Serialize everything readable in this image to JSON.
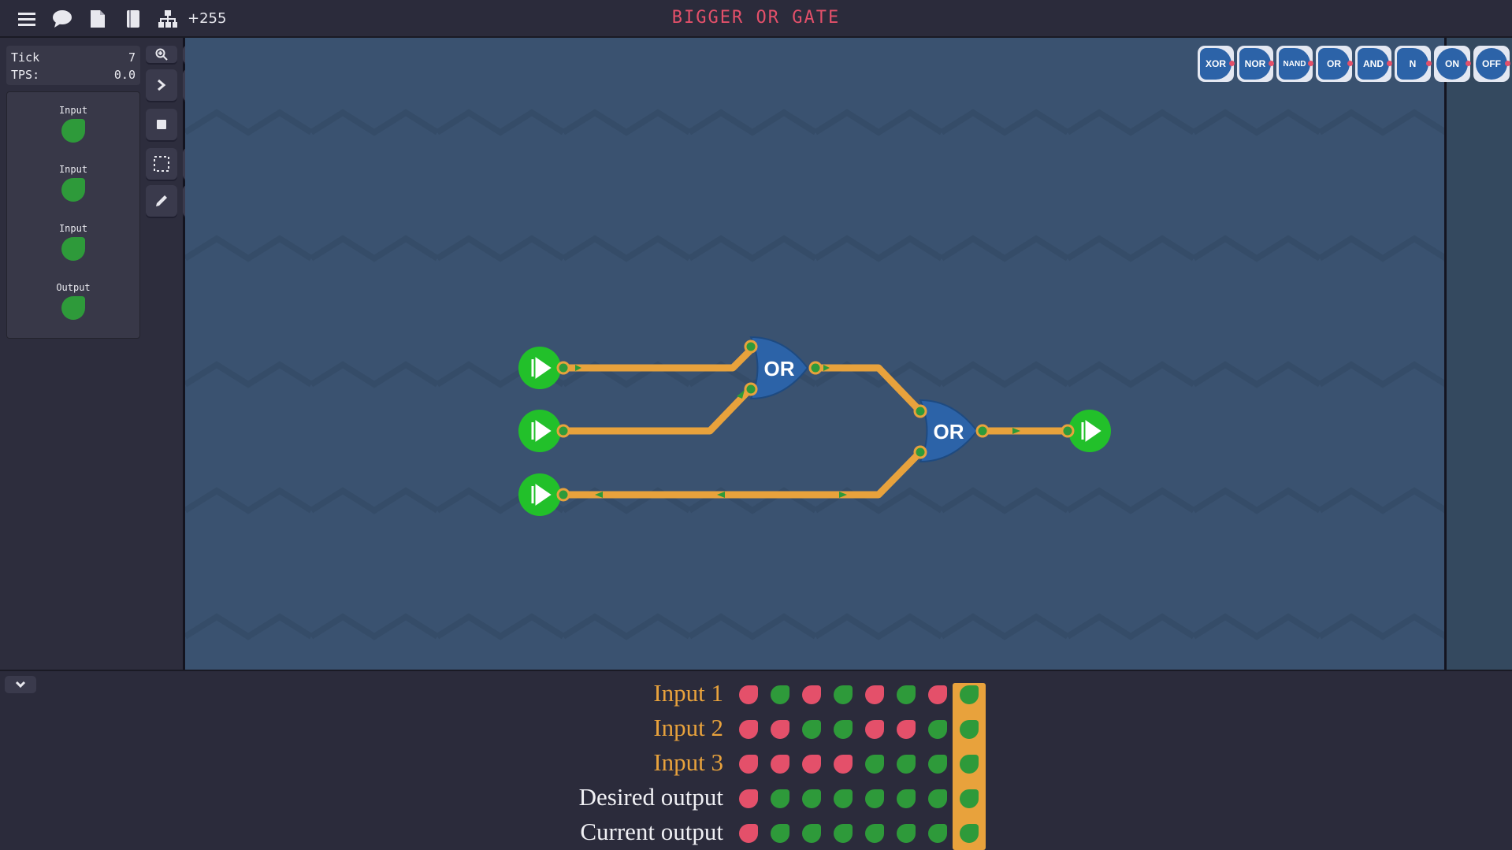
{
  "topbar": {
    "title": "BIGGER OR GATE",
    "counter": "+255",
    "icons": [
      "menu-icon",
      "chat-icon",
      "document-icon",
      "book-icon",
      "hierarchy-icon"
    ]
  },
  "stats": {
    "tick_label": "Tick",
    "tick_value": "7",
    "tps_label": "TPS:",
    "tps_value": "0.0"
  },
  "pins": [
    {
      "label": "Input"
    },
    {
      "label": "Input"
    },
    {
      "label": "Input"
    },
    {
      "label": "Output"
    }
  ],
  "tools": [
    "zoom-in-icon",
    "zoom-out-icon",
    "step-icon",
    "play-icon",
    "stop-icon",
    "select-icon",
    "trash-icon",
    "pencil-icon",
    "color-ring-icon"
  ],
  "palette": [
    "XOR",
    "NOR",
    "NAND",
    "OR",
    "AND",
    "N",
    "ON",
    "OFF"
  ],
  "circuit": {
    "gates": [
      {
        "label": "OR"
      },
      {
        "label": "OR"
      }
    ]
  },
  "colors": {
    "on": "#2e9a3a",
    "off": "#e4506a",
    "wire": "#e8a23c",
    "gate": "#2c63a8",
    "node": "#22c02a"
  },
  "truth_table": {
    "rows": [
      {
        "label": "Input 1",
        "color": "#e8a23c",
        "values": [
          0,
          1,
          0,
          1,
          0,
          1,
          0,
          1
        ]
      },
      {
        "label": "Input 2",
        "color": "#e8a23c",
        "values": [
          0,
          0,
          1,
          1,
          0,
          0,
          1,
          1
        ]
      },
      {
        "label": "Input 3",
        "color": "#e8a23c",
        "values": [
          0,
          0,
          0,
          0,
          1,
          1,
          1,
          1
        ]
      },
      {
        "label": "Desired output",
        "color": "#f0f0f4",
        "values": [
          0,
          1,
          1,
          1,
          1,
          1,
          1,
          1
        ]
      },
      {
        "label": "Current output",
        "color": "#f0f0f4",
        "values": [
          0,
          1,
          1,
          1,
          1,
          1,
          1,
          1
        ]
      }
    ],
    "highlighted_column": 7
  }
}
